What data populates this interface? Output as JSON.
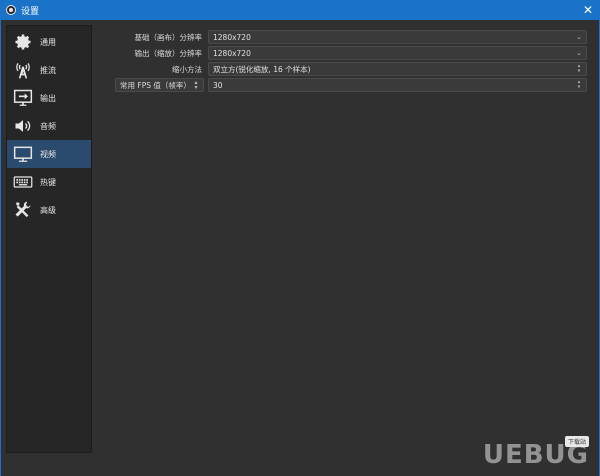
{
  "window": {
    "title": "设置",
    "close_glyph": "✕"
  },
  "sidebar": {
    "items": [
      {
        "label": "通用",
        "icon": "gear-icon",
        "active": false
      },
      {
        "label": "推流",
        "icon": "broadcast-tower-icon",
        "active": false
      },
      {
        "label": "输出",
        "icon": "monitor-output-icon",
        "active": false
      },
      {
        "label": "音频",
        "icon": "speaker-icon",
        "active": false
      },
      {
        "label": "视频",
        "icon": "monitor-icon",
        "active": true
      },
      {
        "label": "热键",
        "icon": "keyboard-icon",
        "active": false
      },
      {
        "label": "高级",
        "icon": "tools-icon",
        "active": false
      }
    ]
  },
  "video": {
    "base_resolution": {
      "label": "基础（画布）分辨率",
      "value": "1280x720"
    },
    "output_resolution": {
      "label": "输出（缩放）分辨率",
      "value": "1280x720"
    },
    "downscale_filter": {
      "label": "缩小方法",
      "value": "双立方(锐化缩放, 16 个样本)"
    },
    "fps": {
      "label": "常用 FPS 值（帧率）",
      "value": "30"
    }
  },
  "watermark": {
    "text": "UEBUG",
    "badge": "下载站"
  },
  "colors": {
    "titlebar": "#1b73c9",
    "active_item": "#2a4a6e",
    "panel": "#303030"
  }
}
